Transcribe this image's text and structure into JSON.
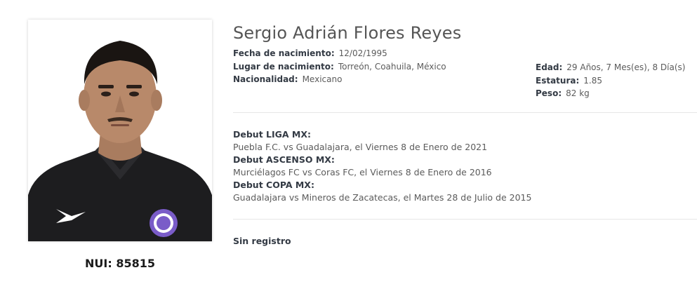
{
  "player": {
    "name": "Sergio Adrián Flores Reyes",
    "nui_label": "NUI: 85815"
  },
  "details_left": [
    {
      "label": "Fecha de nacimiento:",
      "value": "12/02/1995"
    },
    {
      "label": "Lugar de nacimiento:",
      "value": "Torreón, Coahuila, México"
    },
    {
      "label": "Nacionalidad:",
      "value": "Mexicano"
    }
  ],
  "details_right": [
    {
      "label": "Edad:",
      "value": "29 Años, 7 Mes(es), 8 Día(s)"
    },
    {
      "label": "Estatura:",
      "value": "1.85"
    },
    {
      "label": "Peso:",
      "value": "82 kg"
    }
  ],
  "debuts": [
    {
      "label": "Debut LIGA MX:",
      "text": "Puebla F.C. vs Guadalajara, el Viernes 8 de Enero de 2021"
    },
    {
      "label": "Debut ASCENSO MX:",
      "text": "Murciélagos FC vs Coras FC, el Viernes 8 de Enero de 2016"
    },
    {
      "label": "Debut COPA MX:",
      "text": "Guadalajara vs Mineros de Zacatecas, el Martes 28 de Julio de 2015"
    }
  ],
  "no_record_text": "Sin registro",
  "colors": {
    "label": "#333a44",
    "value": "#5b5b5b",
    "divider": "#e6e6e6",
    "badge": "#7a5cc8"
  },
  "icons": {
    "photo": "player-photo",
    "badge": "club-badge-icon",
    "brand": "brand-logo-icon"
  }
}
